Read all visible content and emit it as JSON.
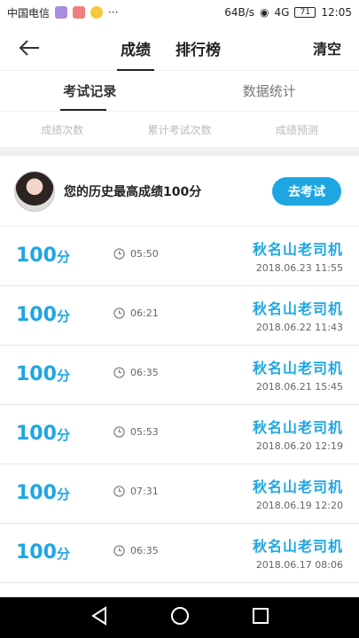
{
  "statusbar": {
    "carrier": "中国电信",
    "speed": "64B/s",
    "network": "4G",
    "battery": "71",
    "time": "12:05"
  },
  "header": {
    "tabs": [
      "成绩",
      "排行榜"
    ],
    "clear_label": "清空"
  },
  "subtabs": [
    "考试记录",
    "数据统计"
  ],
  "stats": [
    "成绩次数",
    "累计考试次数",
    "成绩预测"
  ],
  "best": {
    "text": "您的历史最高成绩100分",
    "button": "去考试"
  },
  "records": [
    {
      "score": "100",
      "unit": "分",
      "time": "05:50",
      "name": "秋名山老司机",
      "date": "2018.06.23  11:55"
    },
    {
      "score": "100",
      "unit": "分",
      "time": "06:21",
      "name": "秋名山老司机",
      "date": "2018.06.22  11:43"
    },
    {
      "score": "100",
      "unit": "分",
      "time": "06:35",
      "name": "秋名山老司机",
      "date": "2018.06.21  15:45"
    },
    {
      "score": "100",
      "unit": "分",
      "time": "05:53",
      "name": "秋名山老司机",
      "date": "2018.06.20  12:19"
    },
    {
      "score": "100",
      "unit": "分",
      "time": "07:31",
      "name": "秋名山老司机",
      "date": "2018.06.19  12:20"
    },
    {
      "score": "100",
      "unit": "分",
      "time": "06:35",
      "name": "秋名山老司机",
      "date": "2018.06.17  08:06"
    }
  ]
}
